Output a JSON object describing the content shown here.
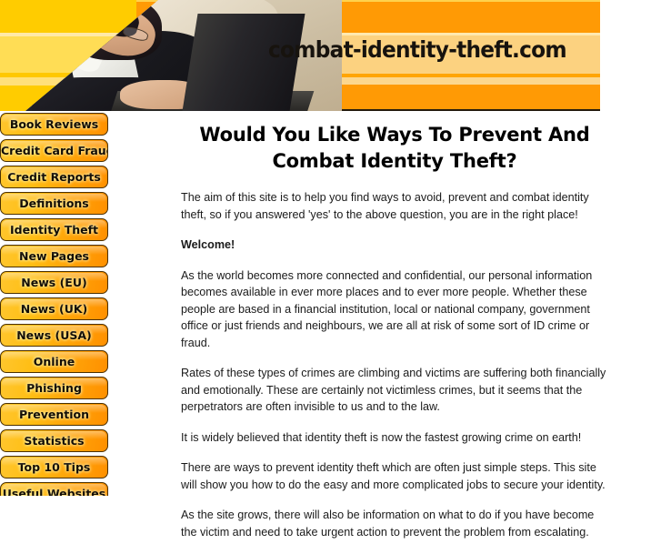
{
  "banner": {
    "site_title": "combat-identity-theft.com",
    "photo_alt": "woman-with-laptop-photo",
    "colors": {
      "orange": "#FF9900",
      "yellow": "#FFCC00",
      "pale": "#FCD280"
    }
  },
  "sidebar": {
    "items": [
      {
        "label": "Book Reviews",
        "name": "sidebar-item-book-reviews"
      },
      {
        "label": "Credit Card Fraud",
        "name": "sidebar-item-credit-card-fraud"
      },
      {
        "label": "Credit Reports",
        "name": "sidebar-item-credit-reports"
      },
      {
        "label": "Definitions",
        "name": "sidebar-item-definitions"
      },
      {
        "label": "Identity Theft",
        "name": "sidebar-item-identity-theft"
      },
      {
        "label": "New Pages",
        "name": "sidebar-item-new-pages"
      },
      {
        "label": "News (EU)",
        "name": "sidebar-item-news-eu"
      },
      {
        "label": "News (UK)",
        "name": "sidebar-item-news-uk"
      },
      {
        "label": "News (USA)",
        "name": "sidebar-item-news-usa"
      },
      {
        "label": "Online",
        "name": "sidebar-item-online"
      },
      {
        "label": "Phishing",
        "name": "sidebar-item-phishing"
      },
      {
        "label": "Prevention",
        "name": "sidebar-item-prevention"
      },
      {
        "label": "Statistics",
        "name": "sidebar-item-statistics"
      },
      {
        "label": "Top 10 Tips",
        "name": "sidebar-item-top-10-tips"
      },
      {
        "label": "Useful Websites",
        "name": "sidebar-item-useful-websites"
      }
    ]
  },
  "main": {
    "title": "Would You Like Ways To Prevent And Combat Identity Theft?",
    "paragraphs": [
      {
        "text": "The aim of this site is to help you find ways to avoid, prevent and combat identity theft, so if you answered 'yes' to the above question, you are in the right place!",
        "bold": false
      },
      {
        "text": "Welcome!",
        "bold": true
      },
      {
        "text": "As the world becomes more connected and confidential, our personal information becomes available in ever more places and to ever more people. Whether these people are based in a financial institution, local or national company, government office or just friends and neighbours, we are all at risk of some sort of ID crime or fraud.",
        "bold": false
      },
      {
        "text": "Rates of these types of crimes are climbing and victims are suffering both financially and emotionally. These are certainly not victimless crimes, but it seems that the perpetrators are often invisible to us and to the law.",
        "bold": false
      },
      {
        "text": "It is widely believed that identity theft is now the fastest growing crime on earth!",
        "bold": false
      },
      {
        "text": "There are ways to prevent identity theft which are often just simple steps. This site will show you how to do the easy and more complicated jobs to secure your identity.",
        "bold": false
      },
      {
        "text": "As the site grows, there will also be information on what to do if you have become the victim and need to take urgent action to prevent the problem from escalating.",
        "bold": false
      }
    ]
  }
}
